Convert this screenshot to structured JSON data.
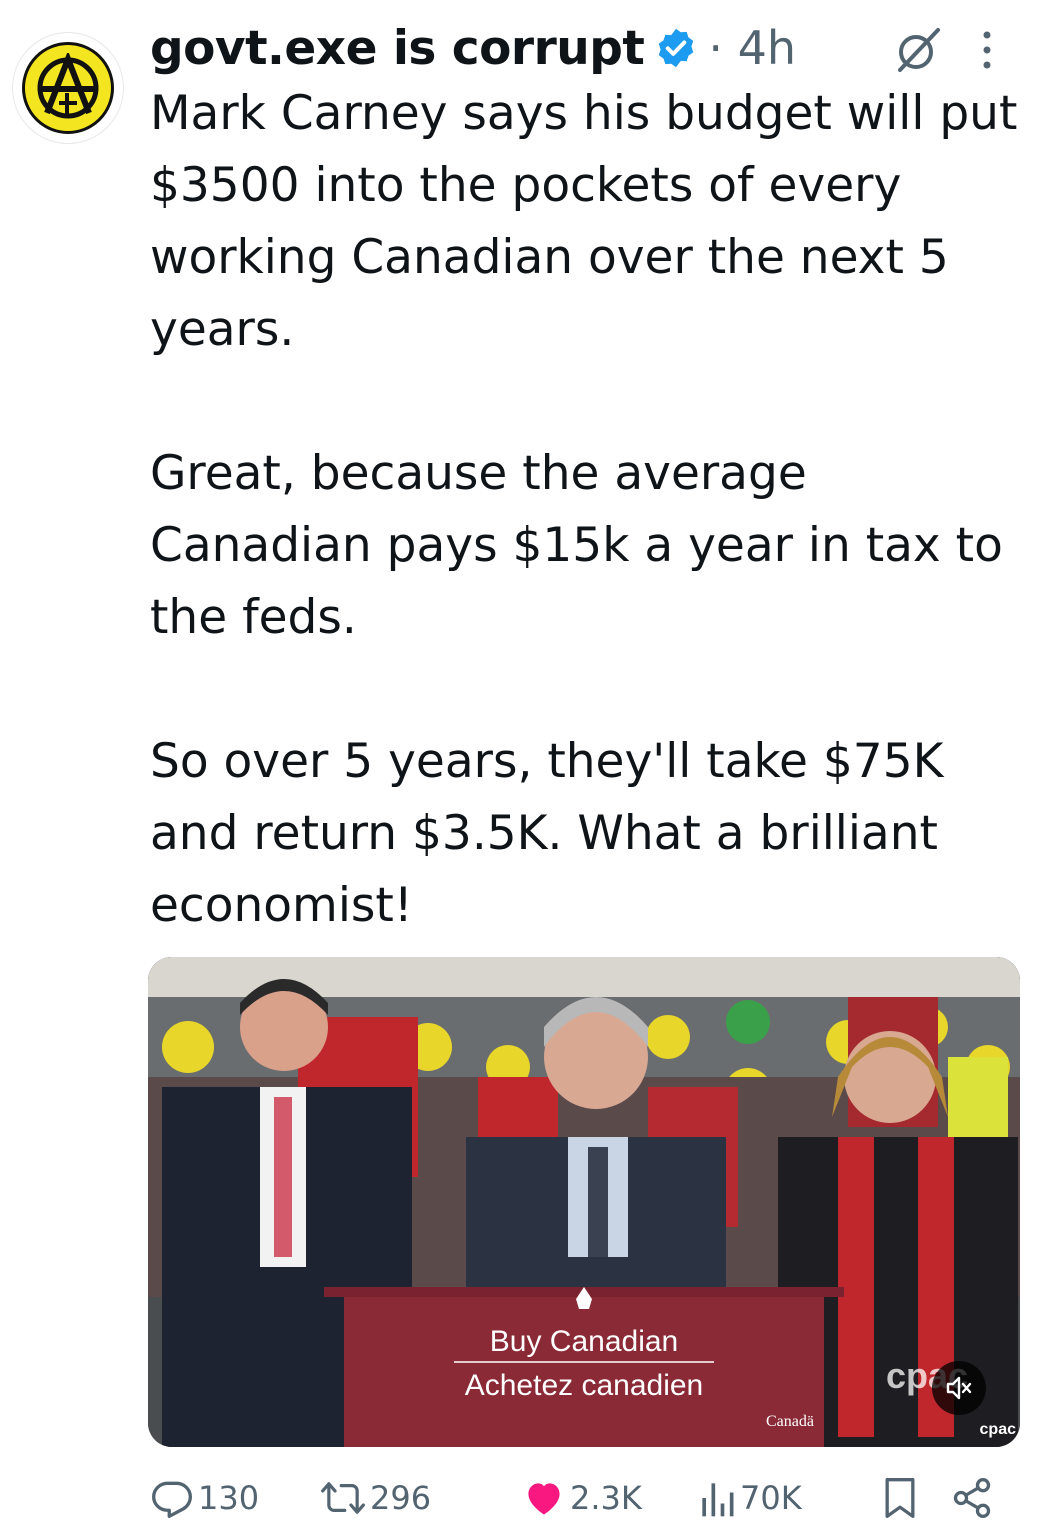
{
  "author": {
    "display_name": "govt.exe is corrupt",
    "verified": true,
    "time_ago": "· 4h"
  },
  "tweet": {
    "paragraphs": [
      "Mark Carney says his budget will put $3500 into the pockets of every working Canadian over the next 5 years.",
      "Great, because the average Canadian pays $15k a year in tax to the feds.",
      "So over 5 years, they'll take $75K and return $3.5K. What a brilliant economist!"
    ]
  },
  "media": {
    "podium_line1": "Buy Canadian",
    "podium_line2": "Achetez canadien",
    "broadcaster": "cpac",
    "broadcaster_watermark": "cpac",
    "wordmark": "Canadä",
    "muted": true
  },
  "actions": {
    "replies": "130",
    "reposts": "296",
    "likes": "2.3K",
    "views": "70K"
  },
  "colors": {
    "like": "#f91880",
    "verified": "#1d9bf0",
    "muted_text": "#536471"
  },
  "icons": [
    "avatar-anarchy-logo",
    "verified-badge-icon",
    "grok-icon",
    "more-icon",
    "mute-icon",
    "reply-icon",
    "repost-icon",
    "like-icon",
    "views-icon",
    "bookmark-icon",
    "share-icon"
  ]
}
